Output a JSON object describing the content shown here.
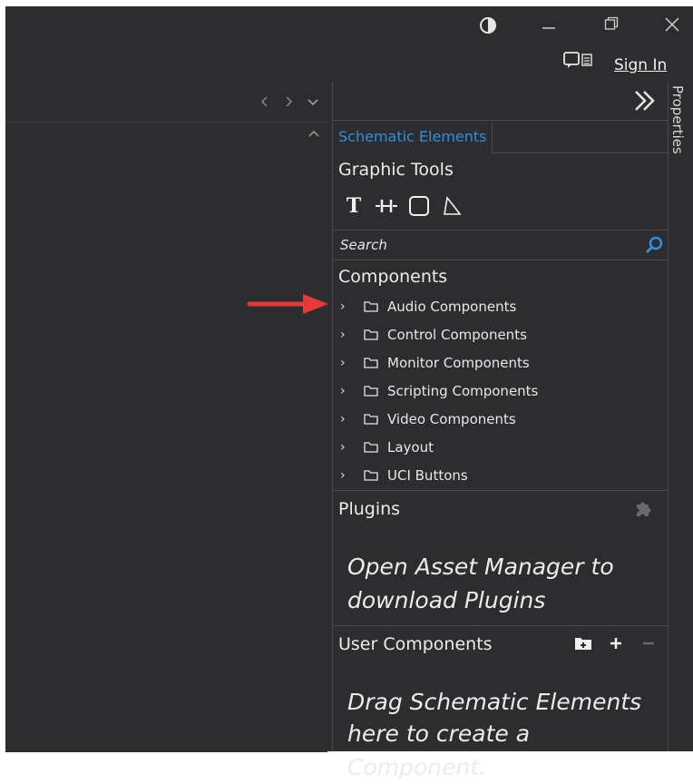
{
  "titlebar": {
    "theme_icon": "contrast-icon",
    "minimize_icon": "minimize-icon",
    "restore_icon": "restore-icon",
    "close_icon": "close-icon",
    "signin_label": "Sign In"
  },
  "doc": {
    "nav_glyphs": "‹›⌄",
    "scroll_up": "^"
  },
  "panel": {
    "properties_label": "Properties",
    "tab_label": "Schematic Elements",
    "graphic_tools_title": "Graphic Tools",
    "tools": [
      "text-tool-icon",
      "wire-tool-icon",
      "rectangle-tool-icon",
      "polygon-tool-icon"
    ],
    "search_label": "Search",
    "components_title": "Components",
    "components": [
      "Audio Components",
      "Control Components",
      "Monitor Components",
      "Scripting Components",
      "Video Components",
      "Layout",
      "UCI Buttons"
    ],
    "plugins_title": "Plugins",
    "plugins_hint_1": "Open Asset Manager to",
    "plugins_hint_2": "download Plugins",
    "user_components_title": "User Components",
    "user_hint_1": "Drag Schematic Elements",
    "user_hint_2": "here to create a Component."
  },
  "colors": {
    "background": "#2d2d30",
    "tab_accent": "#2c8fe0",
    "annotation_arrow": "#e53935"
  }
}
